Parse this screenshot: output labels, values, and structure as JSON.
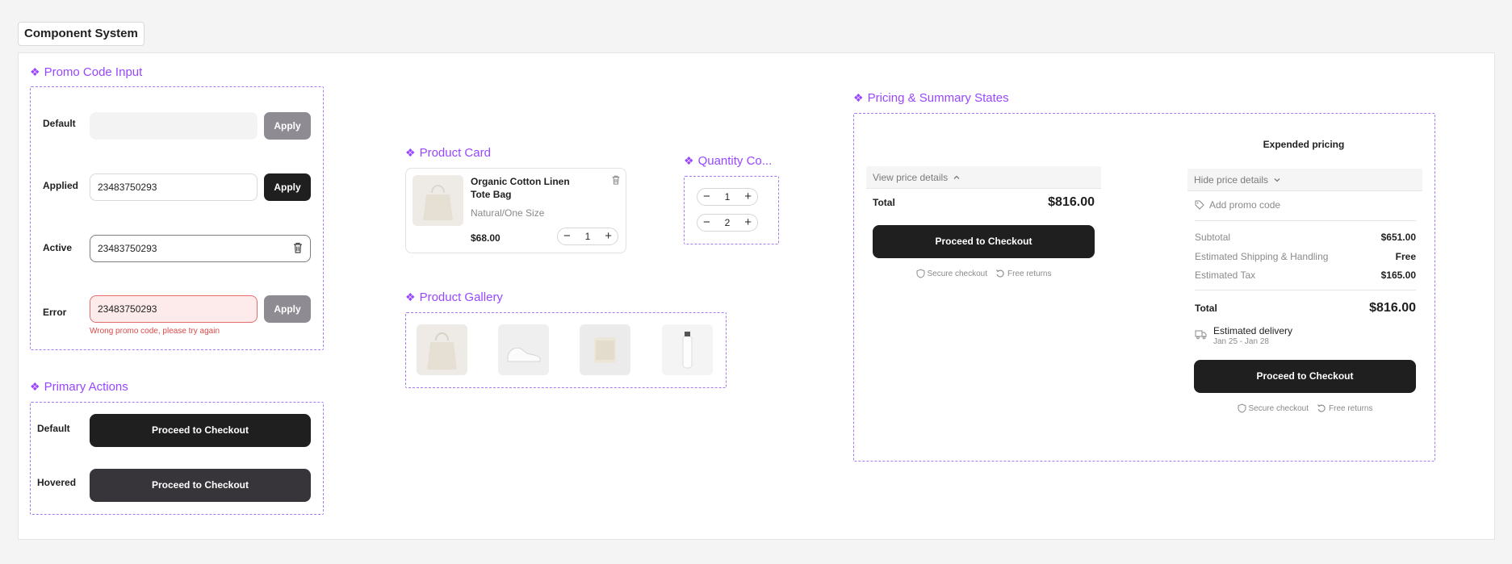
{
  "page": {
    "title": "Component System"
  },
  "promo": {
    "section_label": "Promo Code Input",
    "rows": [
      {
        "label": "Default",
        "value": "",
        "button": "Apply"
      },
      {
        "label": "Applied",
        "value": "23483750293",
        "button": "Apply"
      },
      {
        "label": "Active",
        "value": "23483750293"
      },
      {
        "label": "Error",
        "value": "23483750293",
        "button": "Apply",
        "error": "Wrong promo code, please try again"
      }
    ]
  },
  "primary_actions": {
    "section_label": "Primary Actions",
    "rows": [
      {
        "label": "Default",
        "button": "Proceed to Checkout"
      },
      {
        "label": "Hovered",
        "button": "Proceed to Checkout"
      }
    ]
  },
  "product_card": {
    "section_label": "Product Card",
    "name": "Organic Cotton Linen Tote Bag",
    "variant": "Natural/One Size",
    "price": "$68.00",
    "quantity": "1"
  },
  "quantity_control": {
    "section_label": "Quantity Co...",
    "values": [
      "1",
      "2"
    ]
  },
  "product_gallery": {
    "section_label": "Product Gallery"
  },
  "pricing": {
    "section_label": "Pricing & Summary States",
    "collapsed": {
      "toggle": "View price details",
      "total_label": "Total",
      "total_value": "$816.00",
      "button": "Proceed to Checkout",
      "secure": "Secure checkout",
      "returns": "Free returns"
    },
    "expanded": {
      "heading": "Expended pricing",
      "toggle": "Hide price details",
      "promo_link": "Add promo code",
      "lines": [
        {
          "label": "Subtotal",
          "value": "$651.00"
        },
        {
          "label": "Estimated Shipping & Handling",
          "value": "Free"
        },
        {
          "label": "Estimated Tax",
          "value": "$165.00"
        }
      ],
      "total_label": "Total",
      "total_value": "$816.00",
      "delivery_label": "Estimated delivery",
      "delivery_dates": "Jan 25 - Jan 28",
      "button": "Proceed to Checkout",
      "secure": "Secure checkout",
      "returns": "Free returns"
    }
  },
  "colors": {
    "accent": "#9747ff",
    "dark_button": "#1f1f1f",
    "hover_button": "#37353a",
    "disabled_button": "#8e8b92",
    "error": "#e04848"
  },
  "icons": [
    "component-diamond-icon",
    "trash-icon",
    "minus-icon",
    "plus-icon",
    "chevron-up-icon",
    "chevron-down-icon",
    "tag-icon",
    "shield-icon",
    "refresh-icon",
    "truck-icon"
  ]
}
